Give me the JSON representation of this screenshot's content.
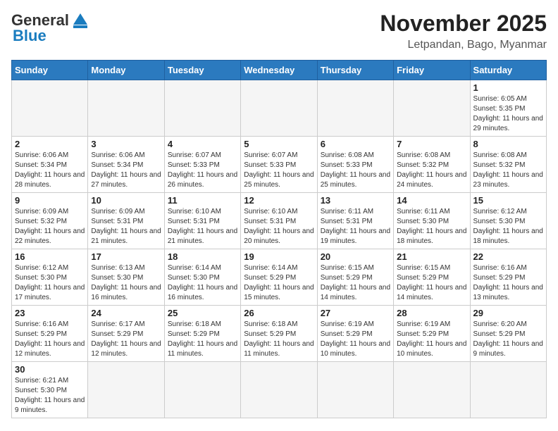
{
  "logo": {
    "general": "General",
    "blue": "Blue"
  },
  "title": "November 2025",
  "subtitle": "Letpandan, Bago, Myanmar",
  "days_of_week": [
    "Sunday",
    "Monday",
    "Tuesday",
    "Wednesday",
    "Thursday",
    "Friday",
    "Saturday"
  ],
  "weeks": [
    [
      {
        "day": "",
        "info": ""
      },
      {
        "day": "",
        "info": ""
      },
      {
        "day": "",
        "info": ""
      },
      {
        "day": "",
        "info": ""
      },
      {
        "day": "",
        "info": ""
      },
      {
        "day": "",
        "info": ""
      },
      {
        "day": "1",
        "info": "Sunrise: 6:05 AM\nSunset: 5:35 PM\nDaylight: 11 hours and 29 minutes."
      }
    ],
    [
      {
        "day": "2",
        "info": "Sunrise: 6:06 AM\nSunset: 5:34 PM\nDaylight: 11 hours and 28 minutes."
      },
      {
        "day": "3",
        "info": "Sunrise: 6:06 AM\nSunset: 5:34 PM\nDaylight: 11 hours and 27 minutes."
      },
      {
        "day": "4",
        "info": "Sunrise: 6:07 AM\nSunset: 5:33 PM\nDaylight: 11 hours and 26 minutes."
      },
      {
        "day": "5",
        "info": "Sunrise: 6:07 AM\nSunset: 5:33 PM\nDaylight: 11 hours and 25 minutes."
      },
      {
        "day": "6",
        "info": "Sunrise: 6:08 AM\nSunset: 5:33 PM\nDaylight: 11 hours and 25 minutes."
      },
      {
        "day": "7",
        "info": "Sunrise: 6:08 AM\nSunset: 5:32 PM\nDaylight: 11 hours and 24 minutes."
      },
      {
        "day": "8",
        "info": "Sunrise: 6:08 AM\nSunset: 5:32 PM\nDaylight: 11 hours and 23 minutes."
      }
    ],
    [
      {
        "day": "9",
        "info": "Sunrise: 6:09 AM\nSunset: 5:32 PM\nDaylight: 11 hours and 22 minutes."
      },
      {
        "day": "10",
        "info": "Sunrise: 6:09 AM\nSunset: 5:31 PM\nDaylight: 11 hours and 21 minutes."
      },
      {
        "day": "11",
        "info": "Sunrise: 6:10 AM\nSunset: 5:31 PM\nDaylight: 11 hours and 21 minutes."
      },
      {
        "day": "12",
        "info": "Sunrise: 6:10 AM\nSunset: 5:31 PM\nDaylight: 11 hours and 20 minutes."
      },
      {
        "day": "13",
        "info": "Sunrise: 6:11 AM\nSunset: 5:31 PM\nDaylight: 11 hours and 19 minutes."
      },
      {
        "day": "14",
        "info": "Sunrise: 6:11 AM\nSunset: 5:30 PM\nDaylight: 11 hours and 18 minutes."
      },
      {
        "day": "15",
        "info": "Sunrise: 6:12 AM\nSunset: 5:30 PM\nDaylight: 11 hours and 18 minutes."
      }
    ],
    [
      {
        "day": "16",
        "info": "Sunrise: 6:12 AM\nSunset: 5:30 PM\nDaylight: 11 hours and 17 minutes."
      },
      {
        "day": "17",
        "info": "Sunrise: 6:13 AM\nSunset: 5:30 PM\nDaylight: 11 hours and 16 minutes."
      },
      {
        "day": "18",
        "info": "Sunrise: 6:14 AM\nSunset: 5:30 PM\nDaylight: 11 hours and 16 minutes."
      },
      {
        "day": "19",
        "info": "Sunrise: 6:14 AM\nSunset: 5:29 PM\nDaylight: 11 hours and 15 minutes."
      },
      {
        "day": "20",
        "info": "Sunrise: 6:15 AM\nSunset: 5:29 PM\nDaylight: 11 hours and 14 minutes."
      },
      {
        "day": "21",
        "info": "Sunrise: 6:15 AM\nSunset: 5:29 PM\nDaylight: 11 hours and 14 minutes."
      },
      {
        "day": "22",
        "info": "Sunrise: 6:16 AM\nSunset: 5:29 PM\nDaylight: 11 hours and 13 minutes."
      }
    ],
    [
      {
        "day": "23",
        "info": "Sunrise: 6:16 AM\nSunset: 5:29 PM\nDaylight: 11 hours and 12 minutes."
      },
      {
        "day": "24",
        "info": "Sunrise: 6:17 AM\nSunset: 5:29 PM\nDaylight: 11 hours and 12 minutes."
      },
      {
        "day": "25",
        "info": "Sunrise: 6:18 AM\nSunset: 5:29 PM\nDaylight: 11 hours and 11 minutes."
      },
      {
        "day": "26",
        "info": "Sunrise: 6:18 AM\nSunset: 5:29 PM\nDaylight: 11 hours and 11 minutes."
      },
      {
        "day": "27",
        "info": "Sunrise: 6:19 AM\nSunset: 5:29 PM\nDaylight: 11 hours and 10 minutes."
      },
      {
        "day": "28",
        "info": "Sunrise: 6:19 AM\nSunset: 5:29 PM\nDaylight: 11 hours and 10 minutes."
      },
      {
        "day": "29",
        "info": "Sunrise: 6:20 AM\nSunset: 5:29 PM\nDaylight: 11 hours and 9 minutes."
      }
    ],
    [
      {
        "day": "30",
        "info": "Sunrise: 6:21 AM\nSunset: 5:30 PM\nDaylight: 11 hours and 9 minutes."
      },
      {
        "day": "",
        "info": ""
      },
      {
        "day": "",
        "info": ""
      },
      {
        "day": "",
        "info": ""
      },
      {
        "day": "",
        "info": ""
      },
      {
        "day": "",
        "info": ""
      },
      {
        "day": "",
        "info": ""
      }
    ]
  ]
}
